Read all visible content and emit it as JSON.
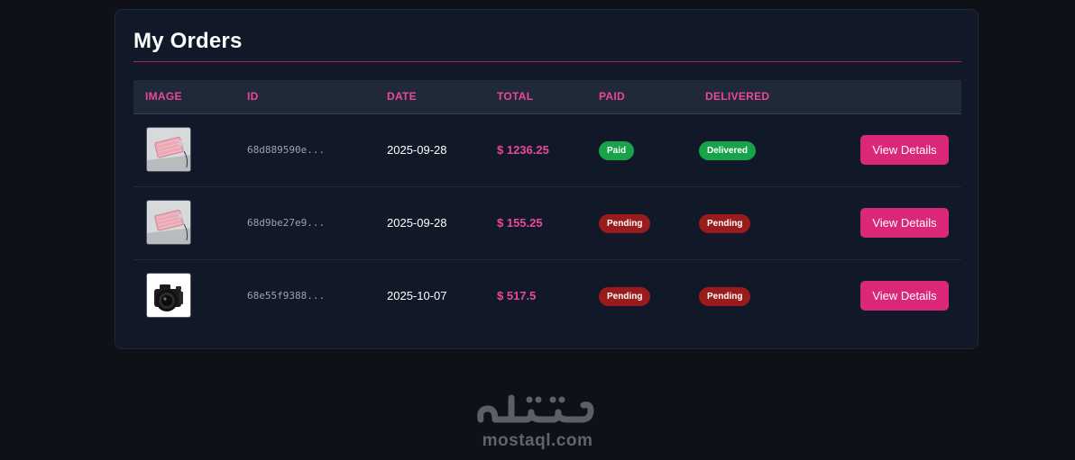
{
  "page": {
    "title": "My Orders"
  },
  "table": {
    "headers": {
      "image": "IMAGE",
      "id": "ID",
      "date": "DATE",
      "total": "TOTAL",
      "paid": "PAID",
      "delivered": "DELIVERED"
    },
    "rows": [
      {
        "image": "pink-handbag-thumbnail",
        "id": "68d889590e...",
        "date": "2025-09-28",
        "total": "$ 1236.25",
        "paid": "Paid",
        "paid_status": "ok",
        "delivered": "Delivered",
        "delivered_status": "ok",
        "action": "View Details"
      },
      {
        "image": "pink-handbag-thumbnail",
        "id": "68d9be27e9...",
        "date": "2025-09-28",
        "total": "$ 155.25",
        "paid": "Pending",
        "paid_status": "pending",
        "delivered": "Pending",
        "delivered_status": "pending",
        "action": "View Details"
      },
      {
        "image": "camera-thumbnail",
        "id": "68e55f9388...",
        "date": "2025-10-07",
        "total": "$ 517.5",
        "paid": "Pending",
        "paid_status": "pending",
        "delivered": "Pending",
        "delivered_status": "pending",
        "action": "View Details"
      }
    ]
  },
  "watermark": {
    "arabic": "مستقل",
    "domain": "mostaql.com"
  },
  "colors": {
    "background": "#0e1117",
    "card": "#111827",
    "header_row": "#1f2937",
    "accent": "#ec4899",
    "button": "#db2777",
    "badge_ok": "#16a34a",
    "badge_pending": "#991b1b"
  }
}
